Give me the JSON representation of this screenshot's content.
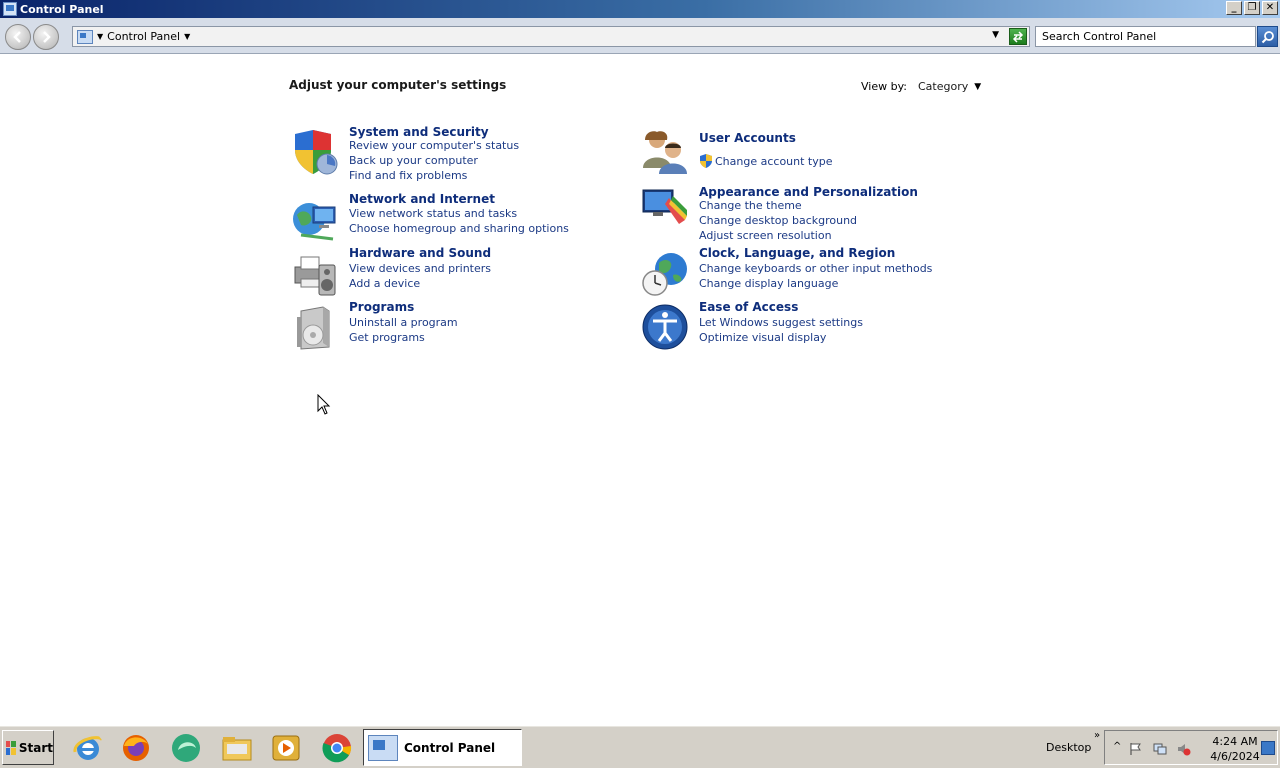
{
  "window": {
    "title": "Control Panel",
    "buttons": [
      "_",
      "❐",
      "✕"
    ]
  },
  "addressbar": {
    "crumb": "Control Panel",
    "search_placeholder": "Search Control Panel"
  },
  "main": {
    "heading": "Adjust your computer's settings",
    "view_by": {
      "label": "View by:",
      "value": "Category"
    },
    "categories_left": [
      {
        "title": "System and Security",
        "links": [
          "Review your computer's status",
          "Back up your computer",
          "Find and fix problems"
        ]
      },
      {
        "title": "Network and Internet",
        "links": [
          "View network status and tasks",
          "Choose homegroup and sharing options"
        ]
      },
      {
        "title": "Hardware and Sound",
        "links": [
          "View devices and printers",
          "Add a device"
        ]
      },
      {
        "title": "Programs",
        "links": [
          "Uninstall a program",
          "Get programs"
        ]
      }
    ],
    "categories_right": [
      {
        "title": "User Accounts",
        "links": [
          "Change account type"
        ]
      },
      {
        "title": "Appearance and Personalization",
        "links": [
          "Change the theme",
          "Change desktop background",
          "Adjust screen resolution"
        ]
      },
      {
        "title": "Clock, Language, and Region",
        "links": [
          "Change keyboards or other input methods",
          "Change display language"
        ]
      },
      {
        "title": "Ease of Access",
        "links": [
          "Let Windows suggest settings",
          "Optimize visual display"
        ]
      }
    ]
  },
  "taskbar": {
    "start_label": "Start",
    "active_task": "Control Panel",
    "desktop_label": "Desktop",
    "time": "4:24 AM",
    "date": "4/6/2024",
    "pinned": [
      "internet-explorer-icon",
      "firefox-icon",
      "green-app-icon",
      "file-explorer-icon",
      "media-player-icon",
      "chrome-icon"
    ]
  }
}
